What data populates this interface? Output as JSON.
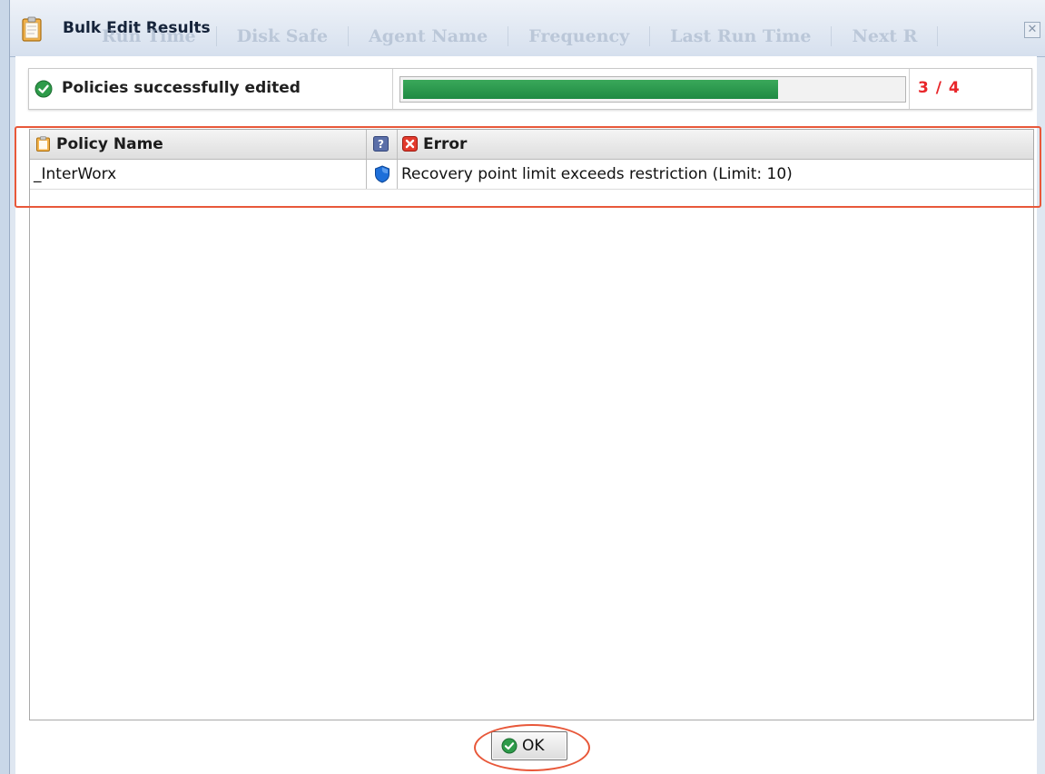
{
  "background_header": {
    "columns": [
      "Run Time",
      "Disk Safe",
      "Agent Name",
      "Frequency",
      "Last Run Time",
      "Next R"
    ]
  },
  "dialog": {
    "title": "Bulk Edit Results",
    "close_label": "✕"
  },
  "progress": {
    "status_text": "Policies successfully edited",
    "counter": "3 / 4",
    "completed": 3,
    "total": 4,
    "fill_fraction": 0.75
  },
  "grid": {
    "columns": {
      "policy_name": "Policy Name",
      "help": "",
      "error": "Error"
    },
    "rows": [
      {
        "policy_name": "_InterWorx",
        "error": "Recovery point limit exceeds restriction (Limit: 10)"
      }
    ]
  },
  "buttons": {
    "ok_label": "OK"
  },
  "colors": {
    "progress_fill": "#1f8a43",
    "counter": "#e8262a",
    "annotation": "#e8583a"
  },
  "icons": {
    "title": "clipboard-icon",
    "status": "check-circle-icon",
    "help": "help-icon",
    "error": "error-icon",
    "policy_type": "shield-icon",
    "ok": "check-circle-icon"
  }
}
